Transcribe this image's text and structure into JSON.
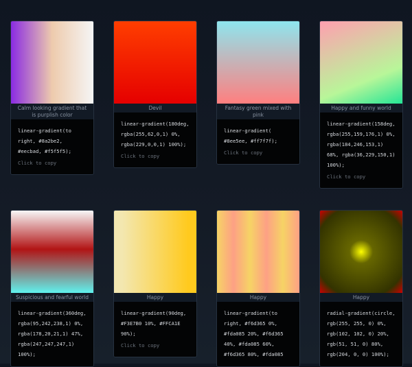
{
  "cards": [
    {
      "title": "Calm looking gradient that is purplish color",
      "css": "linear-gradient(to right, #8a2be2, #eecbad, #f5f5f5)",
      "code": "linear-gradient(to\nright, #8a2be2,\n#eecbad, #f5f5f5);",
      "copy": "Click to copy"
    },
    {
      "title": "Devil",
      "css": "linear-gradient(180deg, rgba(255,62,0,1) 0%, rgba(229,0,0,1) 100%)",
      "code": "linear-gradient(180deg,\nrgba(255,62,0,1) 0%,\nrgba(229,0,0,1) 100%);",
      "copy": "Click to copy"
    },
    {
      "title": "Fantasy green mixed with pink",
      "css": "linear-gradient(#8ee5ee, #ff7f7f)",
      "code": "linear-gradient(\n#8ee5ee, #ff7f7f);",
      "copy": "Click to copy"
    },
    {
      "title": "Happy and funny world",
      "css": "linear-gradient(158deg, rgba(255,159,176,1) 0%, rgba(184,246,153,1) 68%, rgba(36,229,150,1) 100%)",
      "code": "linear-gradient(158deg,\nrgba(255,159,176,1) 0%,\nrgba(184,246,153,1)\n68%, rgba(36,229,150,1)\n100%);",
      "copy": "Click to copy"
    },
    {
      "title": "Suspicious and fearful world",
      "css": "linear-gradient(180deg, rgba(247,247,247,1) 0%, rgba(178,20,21,1) 47%, rgba(95,242,238,1) 100%)",
      "code": "linear-gradient(360deg,\nrgba(95,242,238,1) 0%,\nrgba(178,20,21,1) 47%,\nrgba(247,247,247,1)\n100%);",
      "copy": ""
    },
    {
      "title": "Happy",
      "css": "linear-gradient(90deg, #F3E7B0 10%, #FFCA1E 90%)",
      "code": "linear-gradient(90deg,\n#F3E7B0 10%, #FFCA1E\n90%);",
      "copy": "Click to copy"
    },
    {
      "title": "Happy",
      "css": "linear-gradient(to right, #f6d365 0%, #fda085 20%, #f6d365 40%, #fda085 60%, #f6d365 80%, #fda085 100%)",
      "code": "linear-gradient(to\nright, #f6d365 0%,\n#fda085 20%, #f6d365\n40%, #fda085 60%,\n#f6d365 80%, #fda085",
      "copy": ""
    },
    {
      "title": "Happy",
      "css": "radial-gradient(circle, rgb(255,255,0) 0%, rgb(102,102,0) 20%, rgb(51,51,0) 80%, rgb(204,0,0) 100%)",
      "code": "radial-gradient(circle,\nrgb(255, 255, 0) 0%,\nrgb(102, 102, 0) 20%,\nrgb(51, 51, 0) 80%,\nrgb(204, 0, 0) 100%);",
      "copy": ""
    }
  ]
}
